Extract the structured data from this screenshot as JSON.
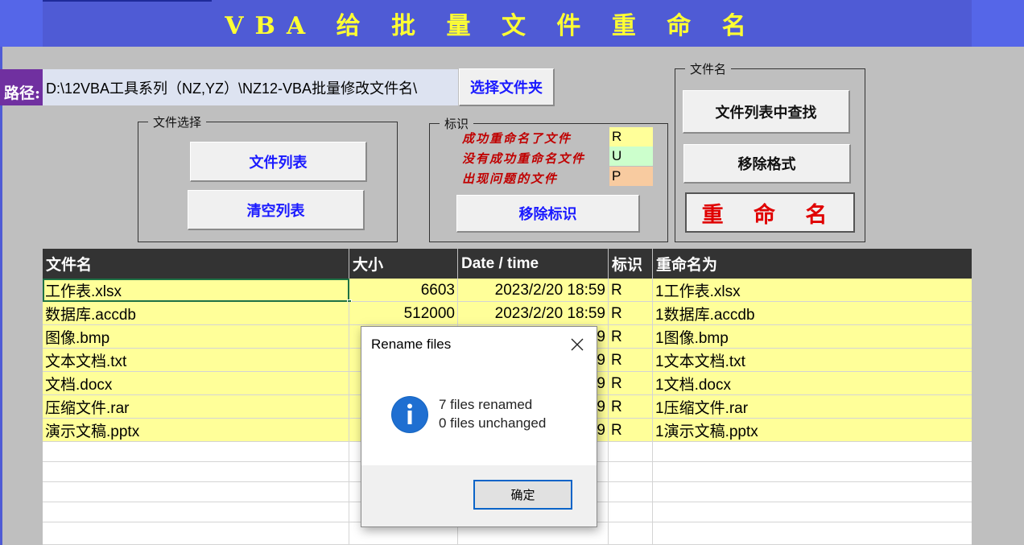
{
  "header": {
    "title": "VBA 给 批 量 文 件 重 命 名"
  },
  "path": {
    "label": "路径:",
    "value": "D:\\12VBA工具系列（NZ,YZ）\\NZ12-VBA批量修改文件名\\"
  },
  "buttons": {
    "select_folder": "选择文件夹",
    "file_list": "文件列表",
    "clear_list": "清空列表",
    "remove_marks": "移除标识",
    "find_in_list": "文件列表中查找",
    "remove_format": "移除格式",
    "rename": "重 命 名"
  },
  "groups": {
    "file_select": "文件选择",
    "marks": "标识",
    "file_name": "文件名"
  },
  "legend": [
    {
      "text": "成功重命名了文件",
      "code": "R",
      "color": "#ffff99"
    },
    {
      "text": "没有成功重命名文件",
      "code": "U",
      "color": "#ccffcc"
    },
    {
      "text": "出现问题的文件",
      "code": "P",
      "color": "#f8cba0"
    }
  ],
  "table": {
    "headers": [
      "文件名",
      "大小",
      "Date / time",
      "标识",
      "重命名为"
    ],
    "rows": [
      {
        "name": "工作表.xlsx",
        "size": "6603",
        "date": "2023/2/20 18:59",
        "mark": "R",
        "new_name": "1工作表.xlsx"
      },
      {
        "name": "数据库.accdb",
        "size": "512000",
        "date": "2023/2/20 18:59",
        "mark": "R",
        "new_name": "1数据库.accdb"
      },
      {
        "name": "图像.bmp",
        "size": "",
        "date": "9",
        "mark": "R",
        "new_name": "1图像.bmp"
      },
      {
        "name": "文本文档.txt",
        "size": "",
        "date": "9",
        "mark": "R",
        "new_name": "1文本文档.txt"
      },
      {
        "name": "文档.docx",
        "size": "",
        "date": "9",
        "mark": "R",
        "new_name": "1文档.docx"
      },
      {
        "name": "压缩文件.rar",
        "size": "",
        "date": "9",
        "mark": "R",
        "new_name": "1压缩文件.rar"
      },
      {
        "name": "演示文稿.pptx",
        "size": "",
        "date": "9",
        "mark": "R",
        "new_name": "1演示文稿.pptx"
      }
    ]
  },
  "dialog": {
    "title": "Rename files",
    "line1": "7 files renamed",
    "line2": "0 files unchanged",
    "ok_label": "确定",
    "icon": "info-icon"
  },
  "colors": {
    "title_bar": "#4f5bd5",
    "title_text": "#ffff33",
    "path_label_bg": "#7030a0",
    "row_highlight": "#ffff99",
    "rename_button_text": "#e00000",
    "blue_button_text": "#1a1aff"
  }
}
